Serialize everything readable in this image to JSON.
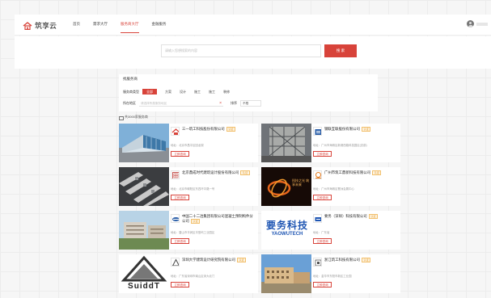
{
  "header": {
    "logo_text": "筑享云",
    "nav": [
      "首页",
      "需求大厅",
      "服务商大厅",
      "金融服务"
    ],
    "active_nav_index": 2
  },
  "search": {
    "placeholder": "请输入您想搜索的内容",
    "button_label": "搜 索"
  },
  "filter": {
    "title": "找服务商",
    "type_label": "服务商类型",
    "types": [
      "全部",
      "方案",
      "设计",
      "施工",
      "施工",
      "装修"
    ],
    "active_type_index": 0,
    "region_label": "所在地区",
    "region_placeholder": "请选择所属服务地区",
    "sort_label": "排序",
    "sort_value": "不限"
  },
  "result_count": "共3000家服务商",
  "cards": [
    {
      "name": "三一筑工科技股份有限公司",
      "badge": "认证",
      "address": "地址：北京市昌平区回龙观",
      "button": "立即咨询"
    },
    {
      "name": "钢联互联股份有限公司",
      "badge": "认证",
      "address": "地址：广州市海珠区新港西路科技园区(总部)",
      "button": "立即咨询"
    },
    {
      "name": "北京鼎成时代建筑设计股份有限公司",
      "badge": "认证",
      "address": "地址：北京市朝阳区东四环中路一号",
      "button": "立即咨询"
    },
    {
      "name": "广州市筑工鼎新科技有限公司",
      "badge": "认证",
      "address": "地址：广州市海珠区琶洲会展中心",
      "button": "立即咨询"
    },
    {
      "name": "中国二十二冶集团有限公司混凝土预制构件分公司",
      "badge": "认证",
      "address": "地址：唐山市丰润区丰登坞工业园区",
      "button": "立即咨询"
    },
    {
      "name": "要务（深圳）科技有限公司",
      "badge": "认证",
      "address": "地址：广东省",
      "button": "立即咨询"
    },
    {
      "name": "深圳大学建筑设计研究院有限公司",
      "badge": "认证",
      "address": "地址：广东省深圳市南山区深大北门",
      "button": "立即咨询"
    },
    {
      "name": "浙江筑工科技有限公司",
      "badge": "认证",
      "address": "地址：金华市东阳市新区工业园",
      "button": "立即咨询"
    }
  ],
  "card_image_text": {
    "suidar": "SuiddT",
    "yaowu_cn": "要务科技",
    "yaowu_en": "YAOWUTECH",
    "hero_text": "科技之光 筑享未来"
  },
  "colors": {
    "accent": "#d8433a",
    "badge": "#e8a33a"
  }
}
